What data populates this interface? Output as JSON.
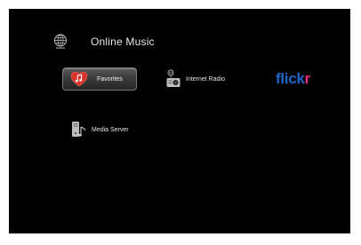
{
  "header": {
    "title": "Online Music",
    "icon": "globe-icon"
  },
  "items": [
    {
      "label": "Favorites",
      "icon": "heart-music-icon",
      "selected": true
    },
    {
      "label": "Internet Radio",
      "icon": "radio-icon"
    },
    {
      "label": "Media Server",
      "icon": "media-server-icon"
    }
  ],
  "flickr": {
    "text_blue": "fl",
    "text_blue2": "ick",
    "text_pink": "r",
    "colors": {
      "blue": "#1e66c9",
      "pink": "#f0287e"
    }
  },
  "colors": {
    "background": "#000000",
    "text": "#e6e6e6",
    "heart": "#d9342b"
  }
}
